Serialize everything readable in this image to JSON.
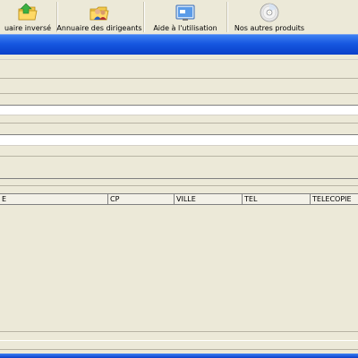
{
  "toolbar": {
    "buttons": [
      {
        "label": "uaire inversé",
        "icon": "folder-arrow-icon"
      },
      {
        "label": "Annuaire des dirigeants",
        "icon": "folder-people-icon"
      },
      {
        "label": "Aide à l'utilisation",
        "icon": "help-screen-icon"
      },
      {
        "label": "Nos autres produits",
        "icon": "cd-disc-icon"
      }
    ]
  },
  "results_table": {
    "columns": [
      "E",
      "CP",
      "VILLE",
      "TEL",
      "TELECOPIE"
    ]
  },
  "colors": {
    "window_bg": "#ece9d8",
    "title_blue": "#1657e0",
    "field_bg": "#ffffff"
  }
}
